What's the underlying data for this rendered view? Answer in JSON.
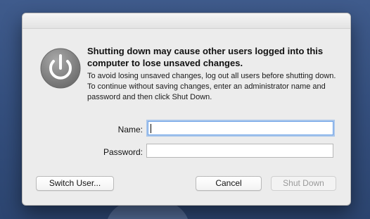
{
  "dialog": {
    "headline": "Shutting down may cause other users logged into this computer to lose unsaved changes.",
    "message": "To avoid losing unsaved changes, log out all users before shutting down. To continue without saving changes, enter an administrator name and password and then click Shut Down."
  },
  "form": {
    "name_label": "Name:",
    "name_value": "",
    "password_label": "Password:",
    "password_value": ""
  },
  "buttons": {
    "switch_user": "Switch User...",
    "cancel": "Cancel",
    "shut_down": "Shut Down"
  },
  "icons": {
    "power": "power-icon"
  },
  "colors": {
    "dialog_background": "#ececec",
    "focus_ring": "#5b99eb",
    "disabled_text": "#9a9a9a"
  }
}
